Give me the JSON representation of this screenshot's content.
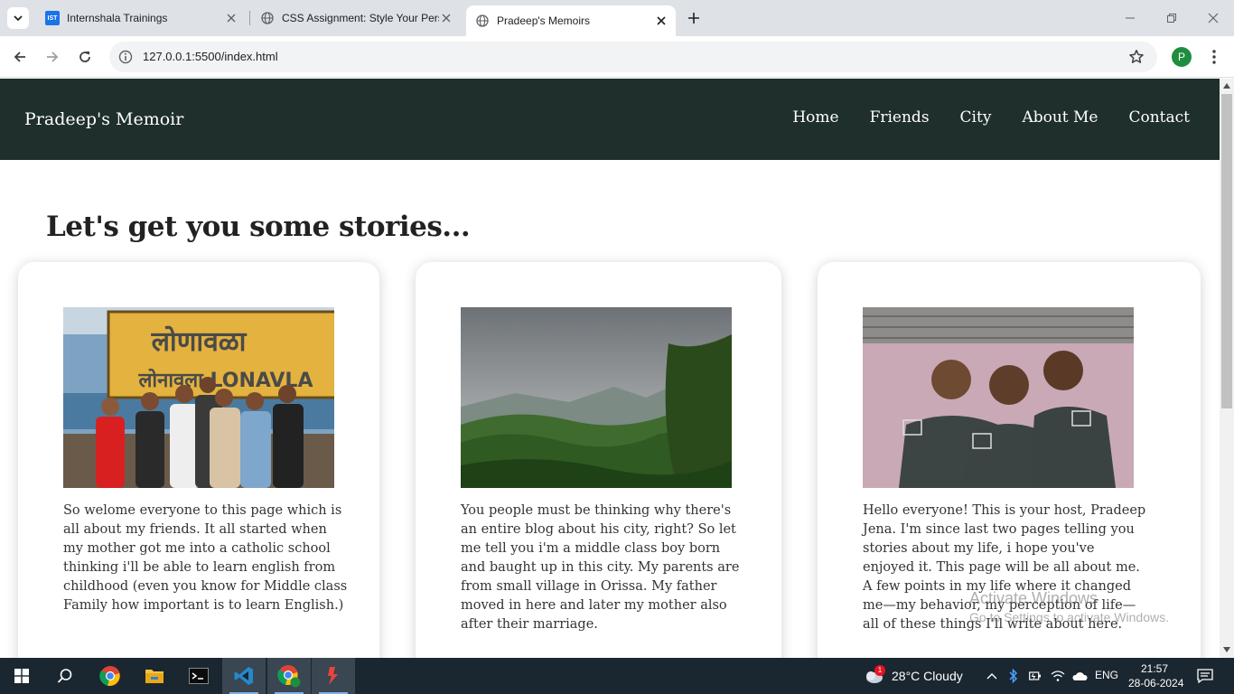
{
  "browser": {
    "tabs": [
      {
        "title": "Internshala Trainings",
        "favicon": "internshala-favicon",
        "active": false
      },
      {
        "title": "CSS Assignment: Style Your Pers",
        "favicon": "globe-icon",
        "active": false
      },
      {
        "title": "Pradeep's Memoirs",
        "favicon": "globe-icon",
        "active": true
      }
    ],
    "favicon_text": "IST",
    "url": "127.0.0.1:5500/index.html",
    "profile_initial": "P"
  },
  "site": {
    "brand": "Pradeep's Memoir",
    "nav": [
      "Home",
      "Friends",
      "City",
      "About Me",
      "Contact"
    ],
    "heading": "Let's get you some stories...",
    "cards": [
      {
        "image": "Group of friends at Lonavla railway station sign",
        "sign_top": "लोणावळा",
        "sign_bottom": "लोनावला LONAVLA",
        "text": "So welome everyone to this page which is all about my friends. It all started when my mother got me into a catholic school thinking i'll be able to learn english from childhood (even you know for Middle class Family how important is to learn English.)"
      },
      {
        "image": "Cloudy sky over green forested hills",
        "text": "You people must be thinking why there's an entire blog about his city, right? So let me tell you i'm a middle class boy born and baught up in this city. My parents are from small village in Orissa. My father moved in here and later my mother also after their marriage."
      },
      {
        "image": "Three friends smiling in dark green t-shirts",
        "text": "Hello everyone! This is your host, Pradeep Jena. I'm since last two pages telling you stories about my life, i hope you've enjoyed it. This page will be all about me. A few points in my life where it changed me—my behavior, my perception of life—all of these things I'll write about here."
      }
    ]
  },
  "watermark": {
    "line1": "Activate Windows",
    "line2": "Go to Settings to activate Windows."
  },
  "taskbar": {
    "weather": "28°C  Cloudy",
    "weather_badge": "1",
    "language": "ENG",
    "time": "21:57",
    "date": "28-06-2024"
  },
  "colors": {
    "header_bg": "#1f2f2b",
    "taskbar_bg": "#1b2730"
  }
}
